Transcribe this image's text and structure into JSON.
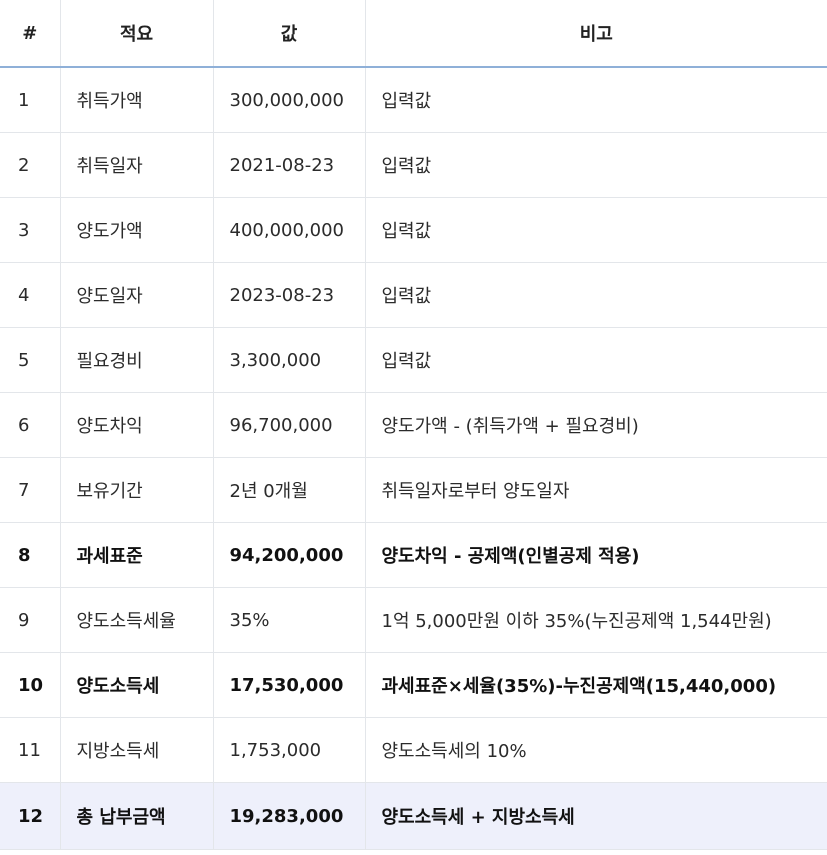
{
  "table": {
    "headers": [
      "#",
      "적요",
      "값",
      "비고"
    ],
    "rows": [
      {
        "num": "1",
        "item": "취득가액",
        "value": "300,000,000",
        "note": "입력값",
        "bold": false,
        "highlight": false
      },
      {
        "num": "2",
        "item": "취득일자",
        "value": "2021-08-23",
        "note": "입력값",
        "bold": false,
        "highlight": false
      },
      {
        "num": "3",
        "item": "양도가액",
        "value": "400,000,000",
        "note": "입력값",
        "bold": false,
        "highlight": false
      },
      {
        "num": "4",
        "item": "양도일자",
        "value": "2023-08-23",
        "note": "입력값",
        "bold": false,
        "highlight": false
      },
      {
        "num": "5",
        "item": "필요경비",
        "value": "3,300,000",
        "note": "입력값",
        "bold": false,
        "highlight": false
      },
      {
        "num": "6",
        "item": "양도차익",
        "value": "96,700,000",
        "note": "양도가액 - (취득가액 + 필요경비)",
        "bold": false,
        "highlight": false
      },
      {
        "num": "7",
        "item": "보유기간",
        "value": "2년 0개월",
        "note": "취득일자로부터 양도일자",
        "bold": false,
        "highlight": false
      },
      {
        "num": "8",
        "item": "과세표준",
        "value": "94,200,000",
        "note": "양도차익 - 공제액(인별공제 적용)",
        "bold": true,
        "highlight": false
      },
      {
        "num": "9",
        "item": "양도소득세율",
        "value": "35%",
        "note": "1억 5,000만원 이하 35%(누진공제액 1,544만원)",
        "bold": false,
        "highlight": false
      },
      {
        "num": "10",
        "item": "양도소득세",
        "value": "17,530,000",
        "note": "과세표준×세율(35%)-누진공제액(15,440,000)",
        "bold": true,
        "highlight": false
      },
      {
        "num": "11",
        "item": "지방소득세",
        "value": "1,753,000",
        "note": "양도소득세의 10%",
        "bold": false,
        "highlight": false
      },
      {
        "num": "12",
        "item": "총 납부금액",
        "value": "19,283,000",
        "note": "양도소득세 + 지방소득세",
        "bold": true,
        "highlight": true
      }
    ]
  },
  "colors": {
    "header_rule": "#8fb0d8",
    "grid": "#e3e6ea",
    "highlight_row": "#eef0fb"
  }
}
